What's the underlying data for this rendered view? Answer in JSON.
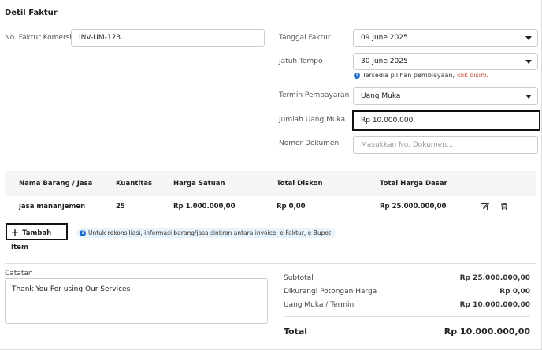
{
  "header": {
    "title": "Detil Faktur"
  },
  "form": {
    "faktur_komersial": {
      "label": "No. Faktur Komersial",
      "value": "INV-UM-123"
    },
    "tanggal_faktur": {
      "label": "Tanggal Faktur",
      "value": "09 June 2025"
    },
    "jatuh_tempo": {
      "label": "Jatuh Tempo",
      "value": "30 June 2025"
    },
    "financing_info": {
      "icon": "info-icon",
      "text": "Tersedia pilihan pembiayaan,",
      "link": "klik disini."
    },
    "termin_pembayaran": {
      "label": "Termin Pembayaran",
      "value": "Uang Muka"
    },
    "jumlah_uang_muka": {
      "label": "Jumlah Uang Muka",
      "value": "Rp 10.000.000"
    },
    "nomor_dokumen": {
      "label": "Nomor Dokumen",
      "placeholder": "Masukkan No. Dokumen..."
    }
  },
  "table": {
    "columns": [
      "Nama Barang / Jasa",
      "Kuantitas",
      "Harga Satuan",
      "Total Diskon",
      "Total Harga Dasar"
    ],
    "rows": [
      {
        "nama": "jasa mananjemen",
        "kuantitas": "25",
        "harga_satuan": "Rp 1.000.000,00",
        "total_diskon": "Rp 0,00",
        "total_harga_dasar": "Rp 25.000.000,00"
      }
    ],
    "add_item_label": "Tambah Item",
    "sync_info": "Untuk rekonsiliasi, informasi barang/jasa sinkron antara invoice, e-Faktur, e-Bupot"
  },
  "notes": {
    "label": "Catatan",
    "value": "Thank You For using Our Services"
  },
  "summary": {
    "subtotal": {
      "label": "Subtotal",
      "value": "Rp 25.000.000,00"
    },
    "potongan": {
      "label": "Dikurangi Potongan Harga",
      "value": "Rp 0,00"
    },
    "uang_muka": {
      "label": "Uang Muka / Termin",
      "value": "Rp 10.000.000,00"
    },
    "total": {
      "label": "Total",
      "value": "Rp 10.000.000,00"
    }
  },
  "colors": {
    "accent_info": "#1e6fd0",
    "link": "#c0392b",
    "table_header_bg": "#f4f5f7"
  }
}
